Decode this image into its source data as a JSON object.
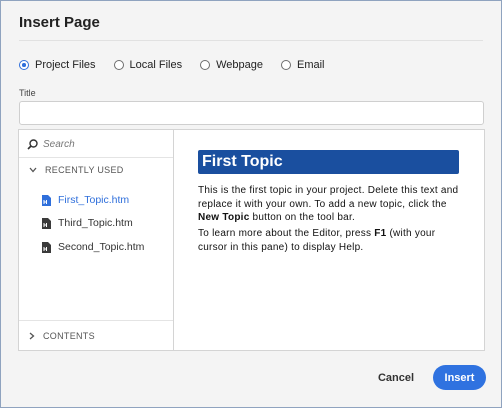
{
  "dialog": {
    "title": "Insert Page"
  },
  "source_options": [
    {
      "label": "Project Files",
      "selected": true
    },
    {
      "label": "Local Files",
      "selected": false
    },
    {
      "label": "Webpage",
      "selected": false
    },
    {
      "label": "Email",
      "selected": false
    }
  ],
  "title_field": {
    "label": "Title",
    "value": ""
  },
  "browser": {
    "search_placeholder": "Search",
    "recently_used_label": "RECENTLY USED",
    "files": [
      {
        "name": "First_Topic.htm",
        "active": true
      },
      {
        "name": "Third_Topic.htm",
        "active": false
      },
      {
        "name": "Second_Topic.htm",
        "active": false
      }
    ],
    "contents_label": "CONTENTS"
  },
  "preview": {
    "heading": "First Topic",
    "p1_a": "This is the first topic in your project. Delete this text and replace it with your own. To add a new topic, click the ",
    "p1_b": "New Topic",
    "p1_c": " button on the tool bar.",
    "p2_a": "To learn more about the Editor, press ",
    "p2_b": "F1",
    "p2_c": " (with your cursor in this pane) to display Help."
  },
  "buttons": {
    "cancel": "Cancel",
    "insert": "Insert"
  },
  "colors": {
    "accent": "#2f72e0",
    "heading_bg": "#1a4f9f",
    "dialog_bg": "#f4f4f4"
  }
}
